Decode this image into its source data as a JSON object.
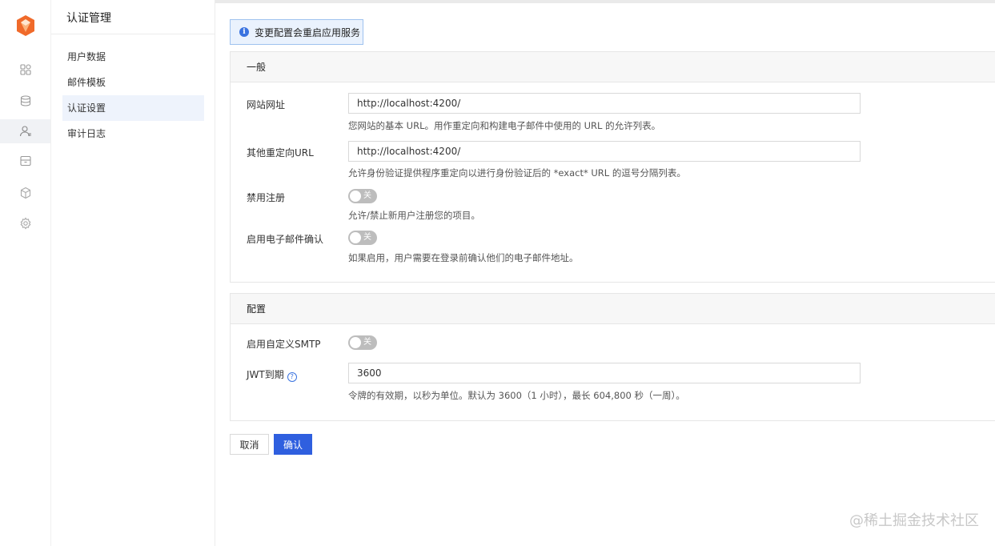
{
  "rail": {
    "icons": [
      "dashboard-icon",
      "database-icon",
      "user-icon",
      "storage-icon",
      "cube-icon",
      "settings-icon"
    ],
    "active_index": 2,
    "brand_color": "#f06a2a"
  },
  "subnav": {
    "title": "认证管理",
    "items": [
      {
        "label": "用户数据"
      },
      {
        "label": "邮件模板"
      },
      {
        "label": "认证设置"
      },
      {
        "label": "审计日志"
      }
    ],
    "active_index": 2
  },
  "notice": {
    "text": "变更配置会重启应用服务"
  },
  "general": {
    "header": "一般",
    "site_url": {
      "label": "网站网址",
      "value": "http://localhost:4200/",
      "help": "您网站的基本 URL。用作重定向和构建电子邮件中使用的 URL 的允许列表。"
    },
    "redirect_url": {
      "label": "其他重定向URL",
      "value": "http://localhost:4200/",
      "help": "允许身份验证提供程序重定向以进行身份验证后的 *exact* URL 的逗号分隔列表。"
    },
    "disable_signup": {
      "label": "禁用注册",
      "state": "关",
      "help": "允许/禁止新用户注册您的项目。"
    },
    "email_confirm": {
      "label": "启用电子邮件确认",
      "state": "关",
      "help": "如果启用，用户需要在登录前确认他们的电子邮件地址。"
    }
  },
  "config": {
    "header": "配置",
    "smtp": {
      "label": "启用自定义SMTP",
      "state": "关"
    },
    "jwt": {
      "label": "JWT到期",
      "help_icon": "?",
      "value": "3600",
      "help": "令牌的有效期，以秒为单位。默认为 3600（1 小时），最长 604,800 秒（一周）。"
    }
  },
  "buttons": {
    "cancel": "取消",
    "confirm": "确认"
  },
  "watermark": "@稀土掘金技术社区",
  "colors": {
    "primary": "#2f5fdf",
    "notice_bg": "#eaf2fd",
    "toggle_off": "#bdbdbd"
  }
}
